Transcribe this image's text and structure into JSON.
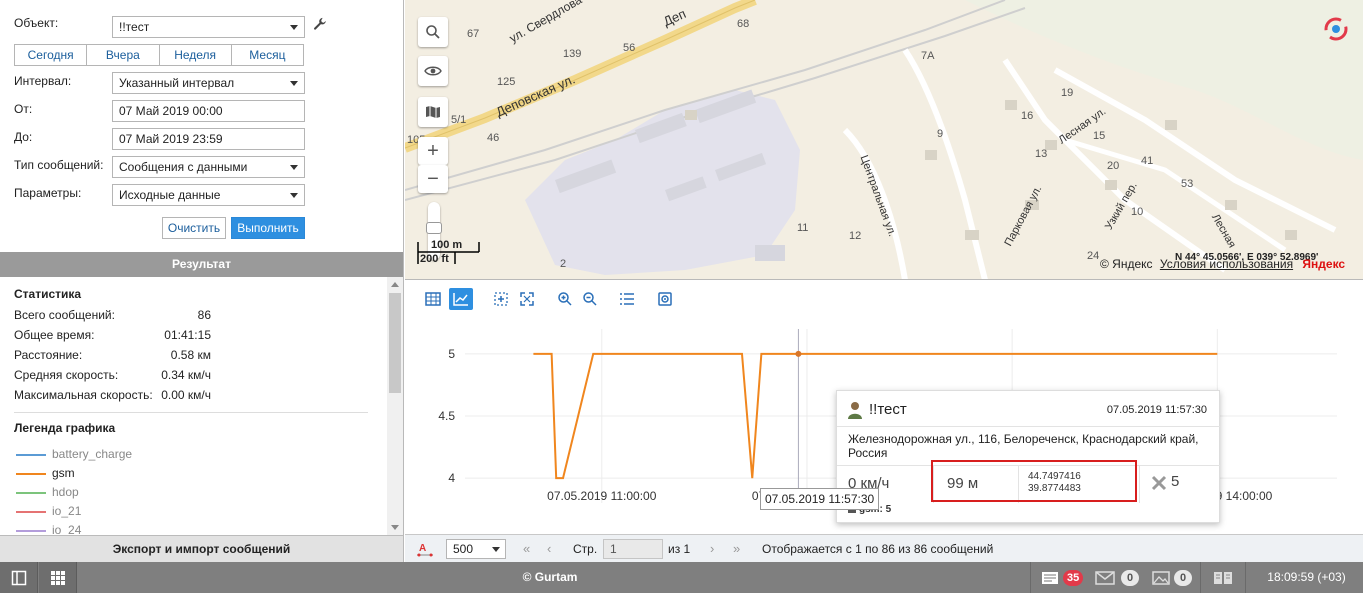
{
  "form": {
    "object_label": "Объект:",
    "object_value": "!!тест",
    "periods": [
      "Сегодня",
      "Вчера",
      "Неделя",
      "Месяц"
    ],
    "interval_label": "Интервал:",
    "interval_value": "Указанный интервал",
    "from_label": "От:",
    "from_value": "07 Май 2019 00:00",
    "to_label": "До:",
    "to_value": "07 Май 2019 23:59",
    "msgtype_label": "Тип сообщений:",
    "msgtype_value": "Сообщения с данными",
    "params_label": "Параметры:",
    "params_value": "Исходные данные",
    "clear_label": "Очистить",
    "run_label": "Выполнить"
  },
  "result": {
    "header": "Результат",
    "stats_title": "Статистика",
    "stats": [
      {
        "label": "Всего сообщений:",
        "value": "86"
      },
      {
        "label": "Общее время:",
        "value": "01:41:15"
      },
      {
        "label": "Расстояние:",
        "value": "0.58 км"
      },
      {
        "label": "Средняя скорость:",
        "value": "0.34 км/ч"
      },
      {
        "label": "Максимальная скорость:",
        "value": "0.00 км/ч"
      }
    ],
    "legend_title": "Легенда графика",
    "legend": [
      {
        "label": "battery_charge",
        "color": "#5b9bd5",
        "active": false
      },
      {
        "label": "gsm",
        "color": "#f0861e",
        "active": true
      },
      {
        "label": "hdop",
        "color": "#7cc47c",
        "active": false
      },
      {
        "label": "io_21",
        "color": "#e57373",
        "active": false
      },
      {
        "label": "io_24",
        "color": "#b39ddb",
        "active": false
      }
    ],
    "export_label": "Экспорт и импорт сообщений"
  },
  "map": {
    "labels": [
      "67",
      "68",
      "139",
      "56",
      "125",
      "5/1",
      "46",
      "7А",
      "19",
      "16",
      "15",
      "20",
      "41",
      "53",
      "11",
      "12",
      "2",
      "10",
      "13",
      "9",
      "24",
      "105"
    ],
    "streets": [
      "ул. Свердлова",
      "Деповская ул.",
      "Деп",
      "Центральная ул.",
      "Парковая ул.",
      "Лесная ул.",
      "Узкий пер.",
      "Лесная"
    ],
    "scale_m": "100 m",
    "scale_ft": "200 ft",
    "copyright": "© Яндекс",
    "terms": "Условия использования",
    "coords": "N 44° 45.0566', E 039° 52.8969'",
    "yandex": "Яндекс"
  },
  "chart_data": {
    "type": "line",
    "series": [
      {
        "name": "gsm",
        "color": "#f0861e",
        "x": [
          "07.05.2019 10:40:00",
          "07.05.2019 10:45:20",
          "07.05.2019 10:46:40",
          "07.05.2019 10:48:40",
          "07.05.2019 10:57:30",
          "07.05.2019 11:05:00",
          "07.05.2019 11:41:00",
          "07.05.2019 11:44:00",
          "07.05.2019 11:46:40",
          "07.05.2019 11:49:30",
          "07.05.2019 11:57:30",
          "07.05.2019 14:00:00"
        ],
        "values": [
          5,
          5,
          4,
          4,
          5,
          5,
          5,
          4,
          5,
          5,
          5,
          5
        ]
      }
    ],
    "x_ticks": [
      "07.05.2019 11:00:00",
      "07.05.2019 12:00:00",
      "07.05.2019 13:00:00",
      "07.05.2019 14:00:00"
    ],
    "y_ticks": [
      "4",
      "4.5",
      "5"
    ],
    "ylim": [
      3.8,
      5.2
    ],
    "grid": true,
    "cursor_label": "07.05.2019 11:57:30"
  },
  "tooltip": {
    "name": "!!тест",
    "time": "07.05.2019 11:57:30",
    "address": "Железнодорожная ул., 116, Белореченск, Краснодарский край, Россия",
    "speed": "0 км/ч",
    "altitude": "99 м",
    "lat": "44.7497416",
    "lon": "39.8774483",
    "satellites": "5",
    "gsm": "gsm: 5"
  },
  "pager": {
    "page_size": "500",
    "page_label": "Стр.",
    "page_value": "1",
    "of_label": "из 1",
    "info": "Отображается с 1 по 86 из 86 сообщений"
  },
  "footer": {
    "brand": "© Gurtam",
    "notifications": "35",
    "messages": "0",
    "media": "0",
    "clock": "18:09:59 (+03)"
  }
}
